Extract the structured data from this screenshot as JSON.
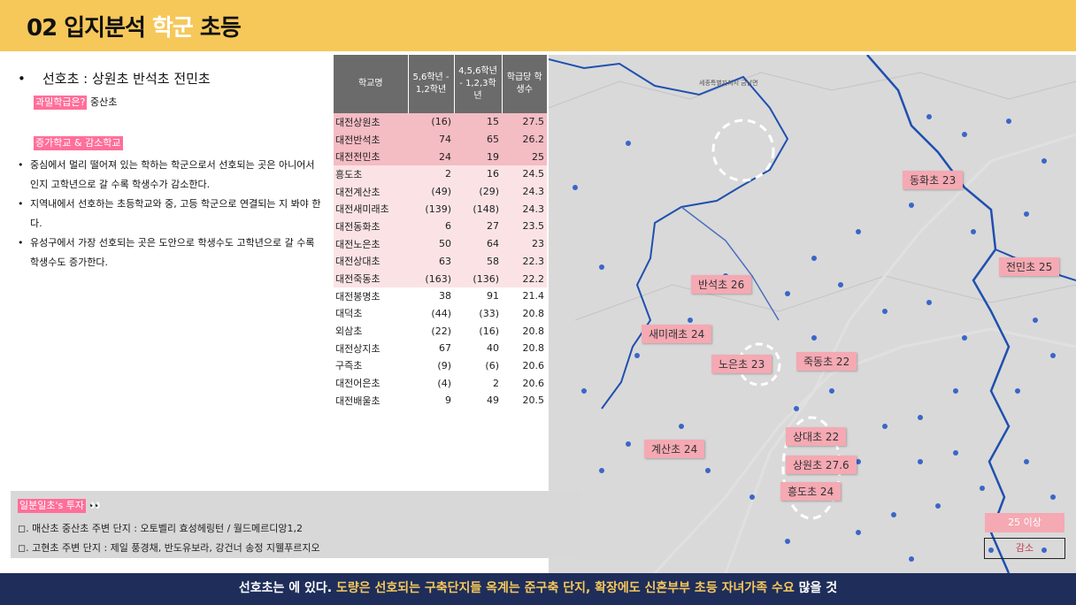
{
  "header": {
    "num": "02",
    "title_a": "입지분석",
    "title_hl": "학군",
    "title_b": "초등"
  },
  "left": {
    "bullet_dot": "•",
    "bullet_main": "선호초 : 상원초 반석초 전민초",
    "tag_overcrowd": "과밀학급은?",
    "overcrowd_value": "중산초",
    "tag_growth": "증가학교 & 감소학교",
    "sub_items": [
      "중심에서 멀리 떨어져 있는 학하는 학군으로서 선호되는 곳은 아니어서인지 고학년으로 갈 수록 학생수가 감소한다.",
      "지역내에서 선호하는 초등학교와 중, 고등 학군으로 연결되는 지 봐야 한다.",
      "유성구에서 가장 선호되는 곳은 도안으로 학생수도 고학년으로 갈 수록 학생수도 증가한다."
    ]
  },
  "table": {
    "headers": [
      "학교명",
      "5,6학년 - 1,2학년",
      "4,5,6학년 - 1,2,3학년",
      "학급당 학생수"
    ],
    "rows": [
      [
        "대전상원초",
        "(16)",
        "15",
        "27.5"
      ],
      [
        "대전반석초",
        "74",
        "65",
        "26.2"
      ],
      [
        "대전전민초",
        "24",
        "19",
        "25"
      ],
      [
        "흥도초",
        "2",
        "16",
        "24.5"
      ],
      [
        "대전계산초",
        "(49)",
        "(29)",
        "24.3"
      ],
      [
        "대전새미래초",
        "(139)",
        "(148)",
        "24.3"
      ],
      [
        "대전동화초",
        "6",
        "27",
        "23.5"
      ],
      [
        "대전노은초",
        "50",
        "64",
        "23"
      ],
      [
        "대전상대초",
        "63",
        "58",
        "22.3"
      ],
      [
        "대전죽동초",
        "(163)",
        "(136)",
        "22.2"
      ],
      [
        "대전봉명초",
        "38",
        "91",
        "21.4"
      ],
      [
        "대덕초",
        "(44)",
        "(33)",
        "20.8"
      ],
      [
        "외삼초",
        "(22)",
        "(16)",
        "20.8"
      ],
      [
        "대전상지초",
        "67",
        "40",
        "20.8"
      ],
      [
        "구즉초",
        "(9)",
        "(6)",
        "20.6"
      ],
      [
        "대전어은초",
        "(4)",
        "2",
        "20.6"
      ],
      [
        "대전배울초",
        "9",
        "49",
        "20.5"
      ]
    ]
  },
  "map": {
    "town_label": "세종특별자치시 금남면",
    "labels": {
      "donghwa": "동화초 23",
      "jeonmin": "전민초 25",
      "banseok": "반석초 26",
      "saemirae": "새미래초 24",
      "noeun": "노은초 23",
      "jukdong": "죽동초 22",
      "sangdae": "상대초 22",
      "gyesan": "계산초 24",
      "sangwon": "상원초 27.6",
      "heungdo": "흥도초 24"
    },
    "legend_high": "25 이상",
    "legend_low": "감소"
  },
  "invest": {
    "tag": "일분일초's 투자",
    "emoji": "👀",
    "lines": [
      "◻. 매산초 중산초 주변 단지 : 오토벨리 효성헤링턴 / 월드메르디앙1,2",
      "◻. 고현초 주변 단지 : 제일 풍경채, 반도유보라, 강건너 송정 지웰푸르지오"
    ]
  },
  "footer": {
    "a": "선호초는 에 있다.",
    "b": "도량은 선호되는 구축단지들 옥계는 준구축 단지, 확장에도 신혼부부 초등 자녀가족 수요",
    "c": "많을 것"
  }
}
